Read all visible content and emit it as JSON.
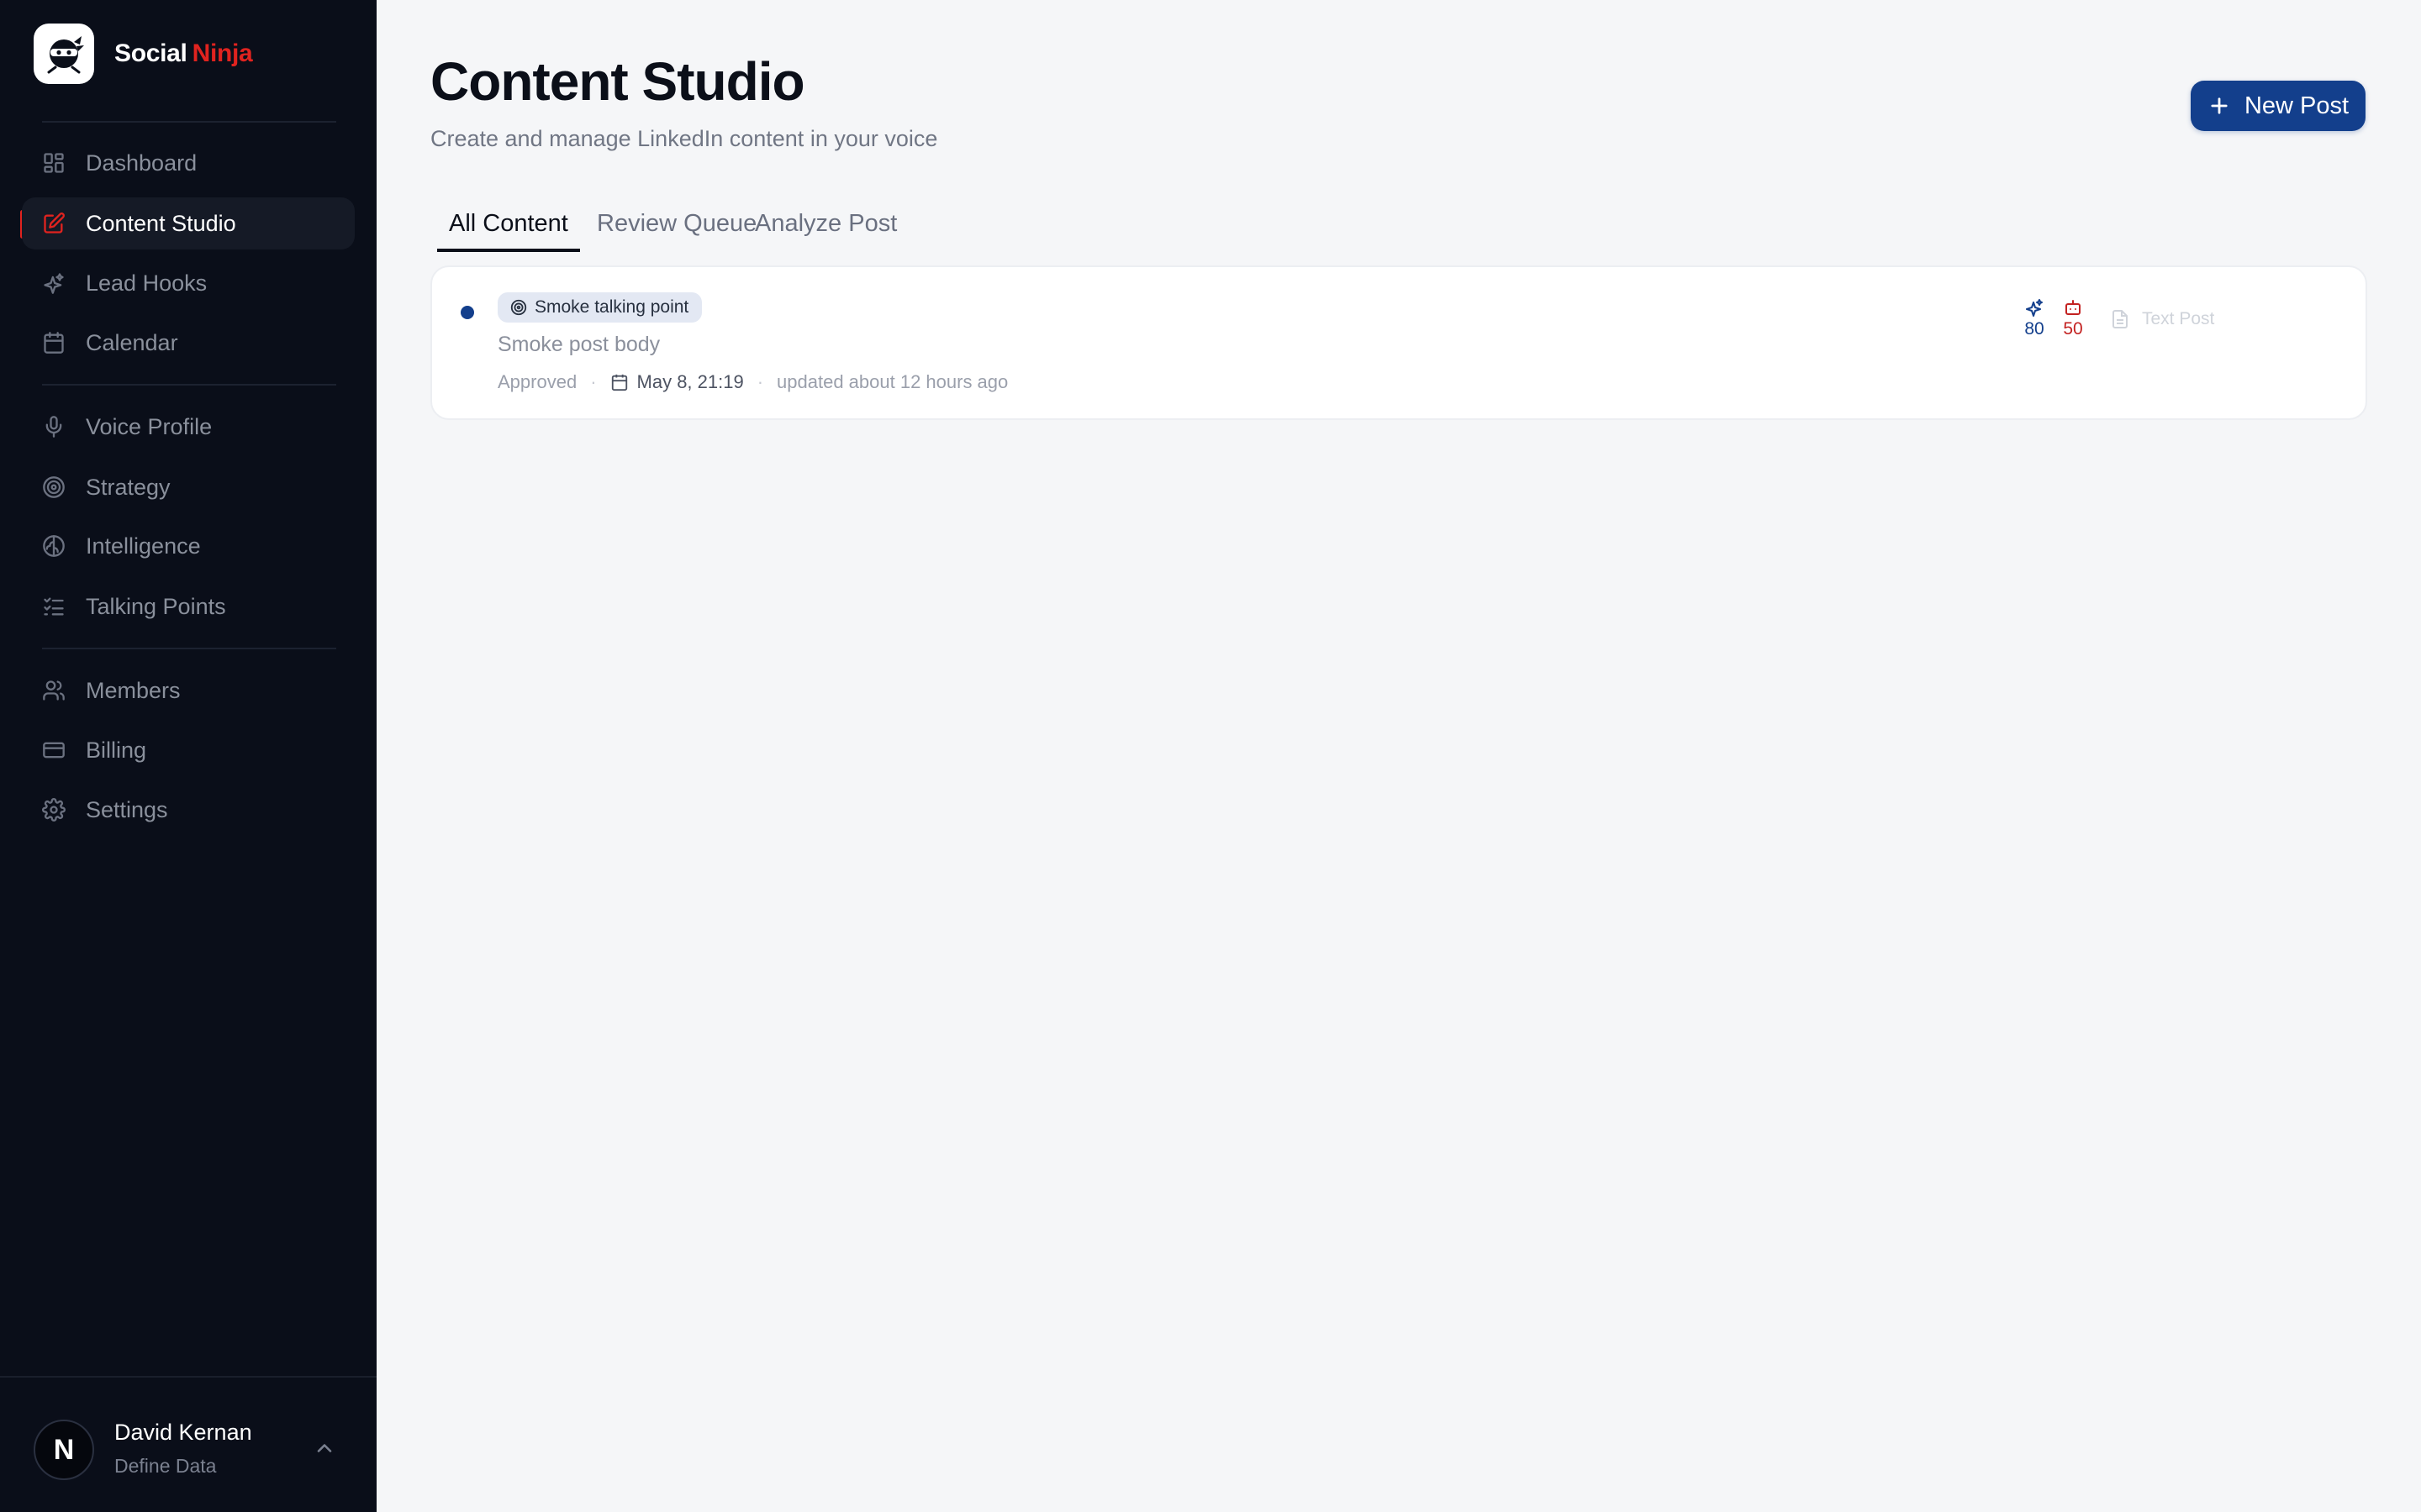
{
  "brand": {
    "name": "Social",
    "accent": "Ninja",
    "accent_color": "#e0231f"
  },
  "nav": {
    "primary": [
      {
        "label": "Dashboard",
        "icon": "dashboard-icon"
      },
      {
        "label": "Content Studio",
        "icon": "edit-icon",
        "active": true
      },
      {
        "label": "Lead Hooks",
        "icon": "sparkle-icon"
      },
      {
        "label": "Calendar",
        "icon": "calendar-icon"
      }
    ],
    "secondary": [
      {
        "label": "Voice Profile",
        "icon": "microphone-icon"
      },
      {
        "label": "Strategy",
        "icon": "target-icon"
      },
      {
        "label": "Intelligence",
        "icon": "brain-icon"
      },
      {
        "label": "Talking Points",
        "icon": "list-check-icon"
      }
    ],
    "tertiary": [
      {
        "label": "Members",
        "icon": "users-icon"
      },
      {
        "label": "Billing",
        "icon": "credit-card-icon"
      },
      {
        "label": "Settings",
        "icon": "gear-icon"
      }
    ]
  },
  "user": {
    "initial": "N",
    "name": "David Kernan",
    "org": "Define Data"
  },
  "header": {
    "title": "Content Studio",
    "subtitle": "Create and manage LinkedIn content in your voice",
    "new_post_label": "New Post"
  },
  "tabs": [
    {
      "label": "All Content",
      "active": true
    },
    {
      "label": "Review Queue"
    },
    {
      "label": "Analyze Post"
    }
  ],
  "posts": [
    {
      "talking_point": "Smoke talking point",
      "body": "Smoke post body",
      "status": "Approved",
      "date": "May 8, 21:19",
      "updated": "updated about 12 hours ago",
      "hook_score": "80",
      "ai_score": "50",
      "type": "Text Post"
    }
  ],
  "colors": {
    "primary": "#133f8c",
    "sidebar_bg": "#0a0e19",
    "accent": "#e0231f"
  }
}
